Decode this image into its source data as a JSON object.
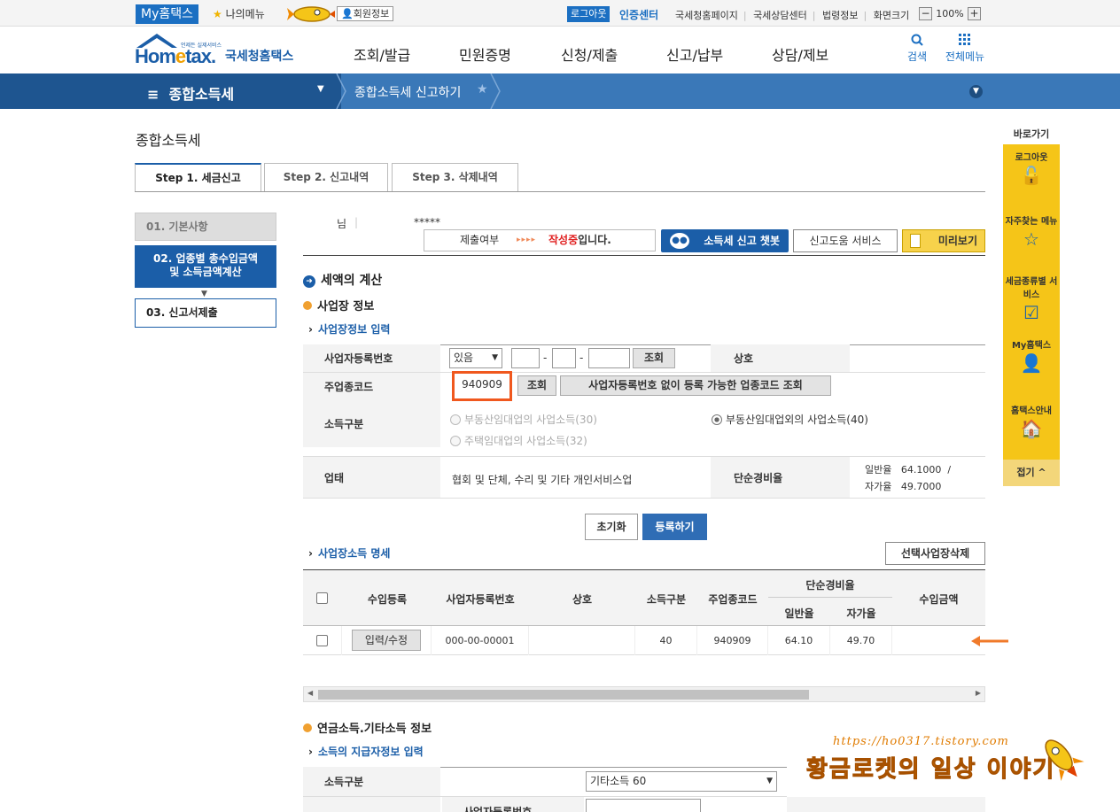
{
  "topbar": {
    "my_hometax": "My홈택스",
    "my_menu": "나의메뉴",
    "member_info": "회원정보",
    "logout": "로그아웃",
    "cert_center": "인증센터",
    "links": [
      "국세청홈페이지",
      "국세상담센터",
      "법령정보",
      "화면크기"
    ],
    "zoom_minus": "−",
    "zoom_value": "100%",
    "zoom_plus": "+"
  },
  "header": {
    "logo_main": "Hometax",
    "logo_e": "e",
    "logo_kr": "국세청홈택스",
    "logo_tag": "언제든 실제서비스",
    "gnb": [
      "조회/발급",
      "민원증명",
      "신청/제출",
      "신고/납부",
      "상담/제보"
    ],
    "search_label": "검색",
    "allmenu_label": "전체메뉴"
  },
  "navbar": {
    "menu_title": "종합소득세",
    "breadcrumb": "종합소득세 신고하기"
  },
  "quick": {
    "title": "바로가기",
    "items": [
      {
        "label": "로그아웃",
        "icon": "unlock-icon"
      },
      {
        "label": "자주찾는 메뉴",
        "icon": "star-icon"
      },
      {
        "label": "세금종류별 서비스",
        "icon": "checkbox-icon"
      },
      {
        "label": "My홈택스",
        "icon": "person-icon"
      },
      {
        "label": "홈택스안내",
        "icon": "home-help-icon"
      }
    ],
    "fold": "접기 ^"
  },
  "page": {
    "title": "종합소득세",
    "tabs": [
      "Step 1. 세금신고",
      "Step 2. 신고내역",
      "Step 3. 삭제내역"
    ]
  },
  "steps": {
    "s1": "01. 기본사항",
    "s2_line1": "02. 업종별 총수입금액",
    "s2_line2": "및 소득금액계산",
    "s3": "03. 신고서제출"
  },
  "info": {
    "nim": "님",
    "masked_name": "*****",
    "submit_label": "제출여부",
    "arrows": "▸▸▸▸",
    "state_red": "작성중",
    "state_rest": "입니다.",
    "chatbot": "소득세 신고 챗봇",
    "help_service": "신고도움 서비스",
    "preview": "미리보기"
  },
  "section": {
    "tax_calc": "세액의 계산",
    "business_info": "사업장 정보",
    "business_input": "사업장정보 입력",
    "business_income_list": "사업장소득 명세",
    "pension_info": "연금소득.기타소득 정보",
    "payer_input": "소득의 지급자정보 입력"
  },
  "form": {
    "bizno_label": "사업자등록번호",
    "bizno_select": "있음",
    "lookup": "조회",
    "sangho_label": "상호",
    "main_code_label": "주업종코드",
    "main_code_value": "940909",
    "code_lookup_nobiz": "사업자등록번호 없이 등록 가능한 업종코드 조회",
    "income_type_label": "소득구분",
    "radio_options": [
      {
        "label": "부동산임대업의 사업소득(30)",
        "checked": false
      },
      {
        "label": "부동산임대업외의 사업소득(40)",
        "checked": true
      },
      {
        "label": "주택임대업의 사업소득(32)",
        "checked": false
      }
    ],
    "uptae_label": "업태",
    "uptae_value": "협회 및 단체, 수리 및 기타 개인서비스업",
    "simple_rate_label": "단순경비율",
    "general_rate": "일반율   64.1000  /",
    "self_rate": "자가율   49.7000",
    "reset": "초기화",
    "register": "등록하기",
    "delete_selected": "선택사업장삭제"
  },
  "grid": {
    "headers": {
      "entry": "수입등록",
      "bizno": "사업자등록번호",
      "sangho": "상호",
      "income_type": "소득구분",
      "main_code": "주업종코드",
      "simple_rate": "단순경비율",
      "general": "일반율",
      "self": "자가율",
      "revenue": "수입금액"
    },
    "rows": [
      {
        "edit": "입력/수정",
        "bizno": "000-00-00001",
        "sangho": "",
        "income_type": "40",
        "main_code": "940909",
        "general": "64.10",
        "self": "49.70",
        "revenue": ""
      }
    ]
  },
  "form2": {
    "income_type_label": "소득구분",
    "income_type_value": "기타소득 60",
    "bizno_label": "사업자등록번호"
  },
  "watermark": {
    "url": "https://ho0317.tistory.com",
    "text": "황금로켓의 일상 이야기"
  },
  "colors": {
    "brand_blue": "#1b5ea8",
    "nav_blue": "#3a78b8",
    "highlight_orange": "#f0581e",
    "quick_yellow": "#f5c518"
  }
}
